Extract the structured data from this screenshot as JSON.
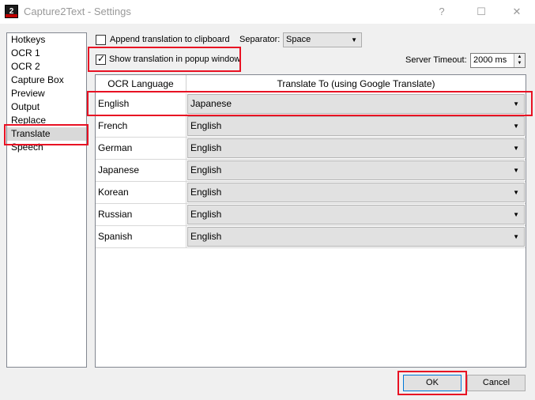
{
  "window": {
    "title": "Capture2Text - Settings",
    "app_icon_glyph": "2",
    "controls": {
      "help": "?",
      "maximize": "☐",
      "close": "✕"
    }
  },
  "sidebar": {
    "items": [
      {
        "label": "Hotkeys"
      },
      {
        "label": "OCR 1"
      },
      {
        "label": "OCR 2"
      },
      {
        "label": "Capture Box"
      },
      {
        "label": "Preview"
      },
      {
        "label": "Output"
      },
      {
        "label": "Replace"
      },
      {
        "label": "Translate"
      },
      {
        "label": "Speech"
      }
    ],
    "selected": "Translate"
  },
  "options": {
    "append_label": "Append translation to clipboard",
    "append_checked": false,
    "show_popup_label": "Show translation in popup window",
    "show_popup_checked": true,
    "show_popup_tick": "✓",
    "separator_label": "Separator:",
    "separator_value": "Space",
    "server_timeout_label": "Server Timeout:",
    "server_timeout_value": "2000 ms"
  },
  "table": {
    "headers": {
      "ocr": "OCR Language",
      "translate": "Translate To (using Google Translate)"
    },
    "rows": [
      {
        "ocr": "English",
        "translate": "Japanese"
      },
      {
        "ocr": "French",
        "translate": "English"
      },
      {
        "ocr": "German",
        "translate": "English"
      },
      {
        "ocr": "Japanese",
        "translate": "English"
      },
      {
        "ocr": "Korean",
        "translate": "English"
      },
      {
        "ocr": "Russian",
        "translate": "English"
      },
      {
        "ocr": "Spanish",
        "translate": "English"
      }
    ]
  },
  "buttons": {
    "ok": "OK",
    "cancel": "Cancel"
  },
  "colors": {
    "highlight": "#e81123",
    "accent": "#0078d7"
  }
}
